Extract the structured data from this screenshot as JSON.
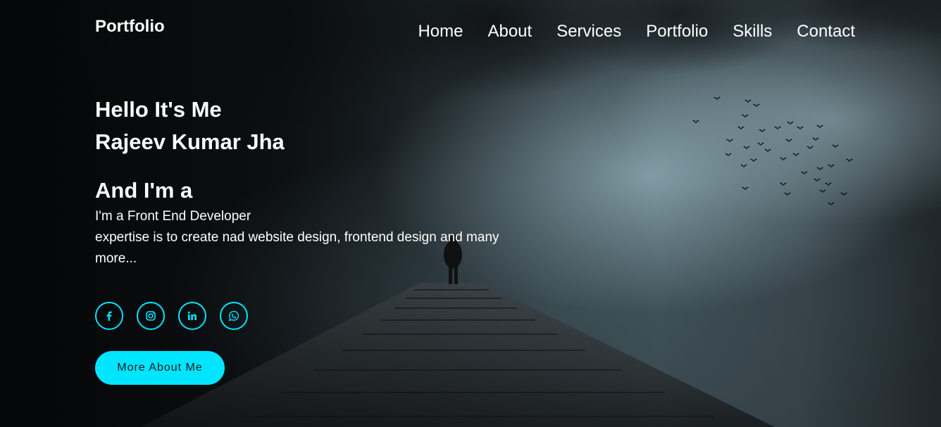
{
  "header": {
    "logo": "Portfolio",
    "nav": [
      {
        "label": "Home"
      },
      {
        "label": "About"
      },
      {
        "label": "Services"
      },
      {
        "label": "Portfolio"
      },
      {
        "label": "Skills"
      },
      {
        "label": "Contact"
      }
    ]
  },
  "hero": {
    "greeting": "Hello It's Me",
    "name": "Rajeev Kumar Jha",
    "role_prefix": "And I'm a",
    "role": "I'm a Front End Developer",
    "description": "expertise is to create nad website design, frontend design and many more..."
  },
  "socials": [
    {
      "icon": "facebook-icon"
    },
    {
      "icon": "instagram-icon"
    },
    {
      "icon": "linkedin-icon"
    },
    {
      "icon": "whatsapp-icon"
    }
  ],
  "cta": {
    "label": "More About Me"
  },
  "colors": {
    "accent": "#00e5ff",
    "text": "#ffffff"
  }
}
